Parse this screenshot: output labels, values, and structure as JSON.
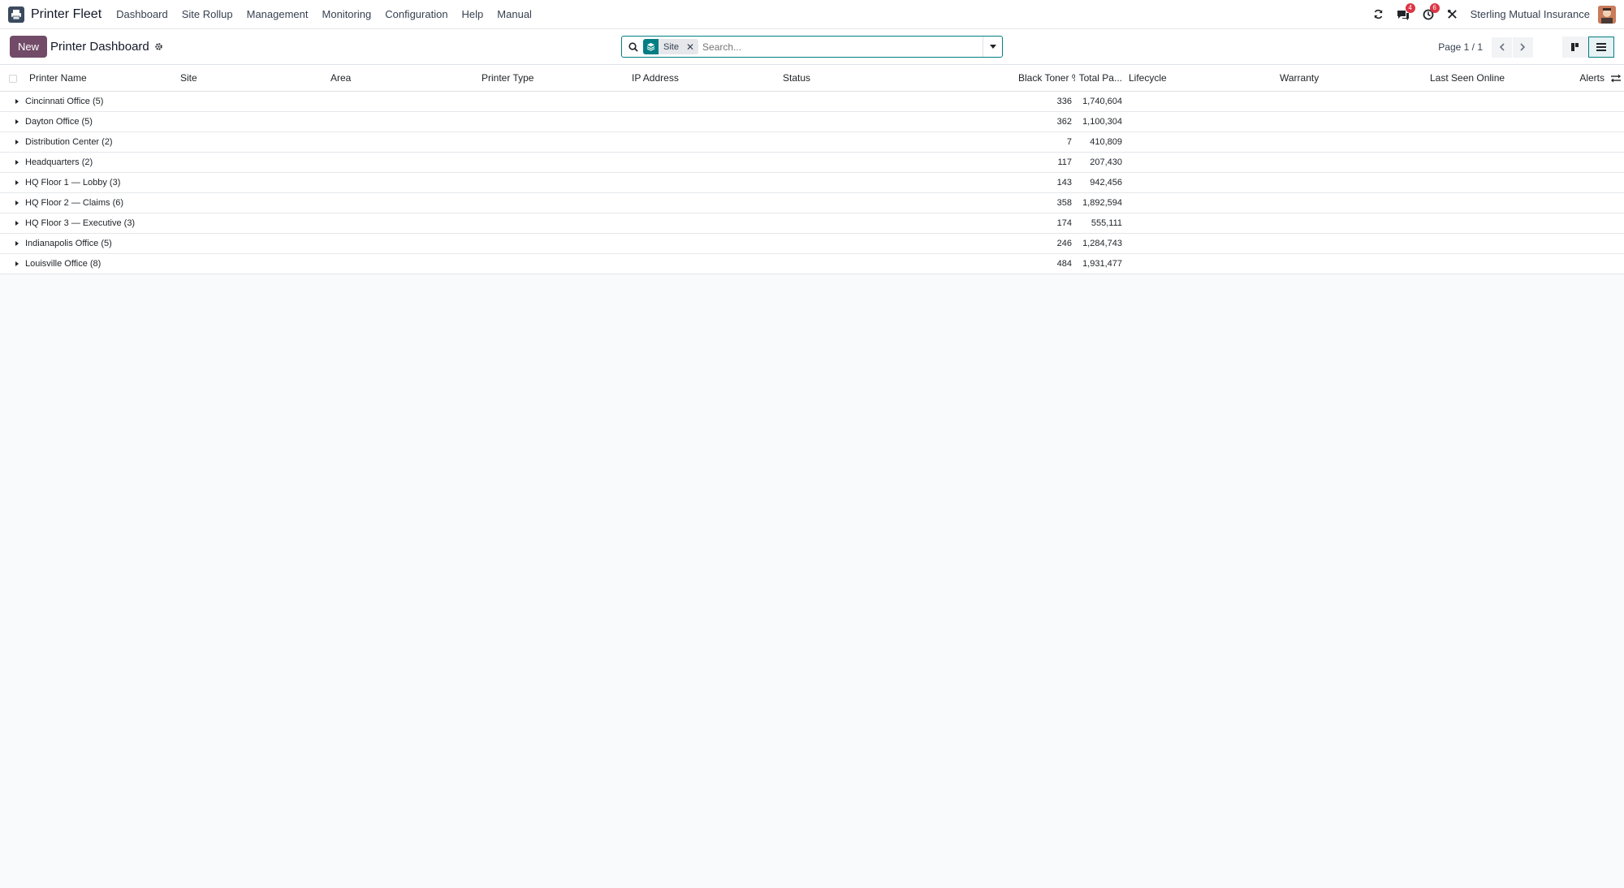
{
  "navbar": {
    "brand": "Printer Fleet",
    "menu": [
      "Dashboard",
      "Site Rollup",
      "Management",
      "Monitoring",
      "Configuration",
      "Help",
      "Manual"
    ],
    "messages_count": "4",
    "activities_count": "6",
    "company": "Sterling Mutual Insurance"
  },
  "control": {
    "new_label": "New",
    "title": "Printer Dashboard",
    "search_facet": "Site",
    "search_placeholder": "Search...",
    "pager": "Page 1 / 1"
  },
  "table": {
    "columns": [
      "Printer Name",
      "Site",
      "Area",
      "Printer Type",
      "IP Address",
      "Status",
      "Black Toner %",
      "Total Pa...",
      "Lifecycle",
      "Warranty",
      "Last Seen Online",
      "Alerts"
    ],
    "groups": [
      {
        "name": "Cincinnati Office (5)",
        "toner": "336",
        "pages": "1,740,604"
      },
      {
        "name": "Dayton Office (5)",
        "toner": "362",
        "pages": "1,100,304"
      },
      {
        "name": "Distribution Center (2)",
        "toner": "7",
        "pages": "410,809"
      },
      {
        "name": "Headquarters (2)",
        "toner": "117",
        "pages": "207,430"
      },
      {
        "name": "HQ Floor 1 — Lobby (3)",
        "toner": "143",
        "pages": "942,456"
      },
      {
        "name": "HQ Floor 2 — Claims (6)",
        "toner": "358",
        "pages": "1,892,594"
      },
      {
        "name": "HQ Floor 3 — Executive (3)",
        "toner": "174",
        "pages": "555,111"
      },
      {
        "name": "Indianapolis Office (5)",
        "toner": "246",
        "pages": "1,284,743"
      },
      {
        "name": "Louisville Office (8)",
        "toner": "484",
        "pages": "1,931,477"
      }
    ]
  },
  "colors": {
    "primary": "#714b67",
    "accent": "#017e84",
    "badge": "#dc3545"
  }
}
